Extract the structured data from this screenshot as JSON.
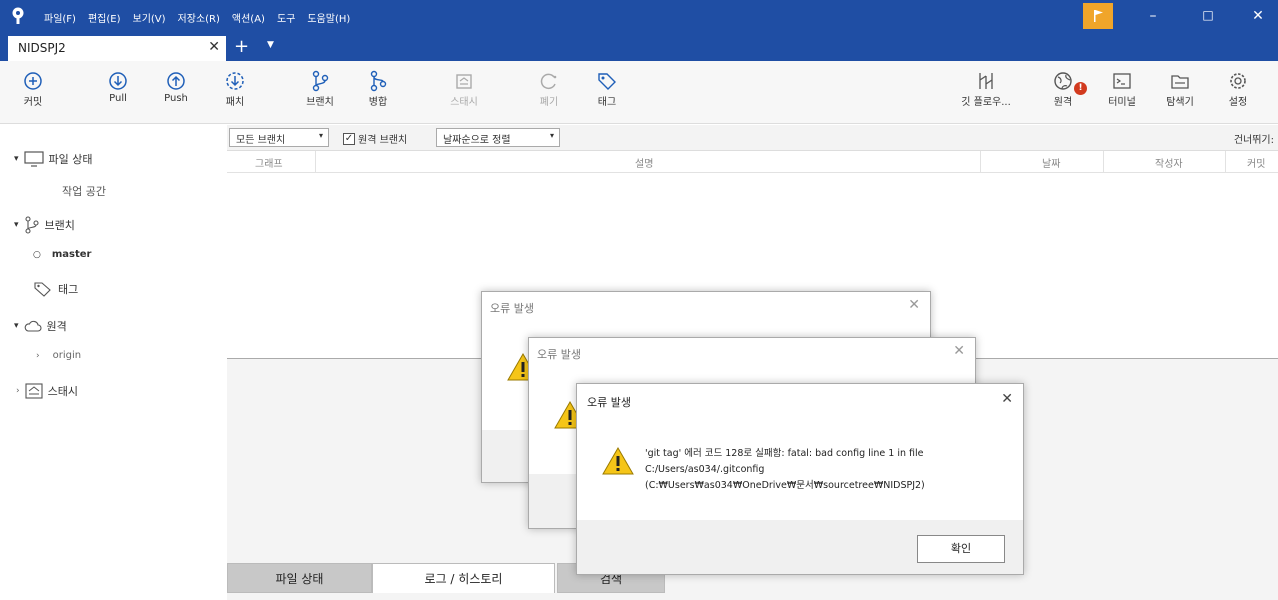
{
  "menu": [
    "파일(F)",
    "편집(E)",
    "보기(V)",
    "저장소(R)",
    "액션(A)",
    "도구",
    "도움말(H)"
  ],
  "window_controls": {
    "minimize": "–",
    "maximize": "□",
    "close": "✕"
  },
  "tab": {
    "label": "NIDSPJ2",
    "close": "✕",
    "add": "+",
    "dropdown": "▼"
  },
  "toolbar": {
    "commit": "커밋",
    "pull": "Pull",
    "push": "Push",
    "fetch": "패치",
    "branch": "브랜치",
    "merge": "병합",
    "stash": "스태시",
    "discard": "폐기",
    "tag": "태그",
    "gitflow": "깃 플로우...",
    "remote": "원격",
    "terminal": "터미널",
    "explorer": "탐색기",
    "settings": "설정",
    "remote_badge": "!"
  },
  "sidebar": {
    "file_status": "파일 상태",
    "workspace": "작업 공간",
    "branches": "브랜치",
    "master": "master",
    "tags": "태그",
    "remotes": "원격",
    "origin": "origin",
    "stashes": "스태시"
  },
  "filters": {
    "branches": "모든 브랜치",
    "show_remote": "원격 브랜치",
    "sort": "날짜순으로 정렬",
    "skip": "건너뛰기:"
  },
  "columns": {
    "graph": "그래프",
    "description": "설명",
    "date": "날짜",
    "author": "작성자",
    "commit": "커밋"
  },
  "bottom_tabs": {
    "file_status": "파일 상태",
    "log": "로그 / 히스토리",
    "search": "검색"
  },
  "dialog": {
    "title": "오류 발생",
    "line1": "'git tag' 에러 코드 128로 실패함: fatal: bad config line 1 in file",
    "line2": "C:/Users/as034/.gitconfig",
    "line3": "(C:₩Users₩as034₩OneDrive₩문서₩sourcetree₩NIDSPJ2)",
    "ok": "확인",
    "close": "✕"
  },
  "colors": {
    "titlebar": "#1f4ea4",
    "accent_flag": "#f0a52a",
    "icon_blue": "#1f5fb8",
    "badge": "#d23a1e"
  }
}
